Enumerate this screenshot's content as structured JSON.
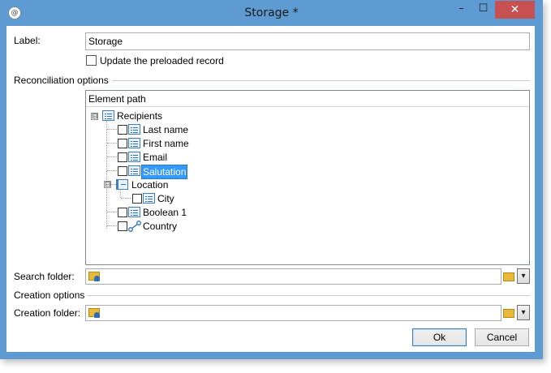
{
  "window": {
    "title": "Storage *",
    "app_icon_glyph": "@",
    "minimize_glyph": "–",
    "maximize_glyph": "☐",
    "close_glyph": "✕"
  },
  "form": {
    "label_caption": "Label:",
    "label_value": "Storage",
    "update_checkbox_label": "Update the preloaded record",
    "update_checked": false
  },
  "reconciliation": {
    "section_title": "Reconciliation options",
    "tree_header": "Element path",
    "nodes": [
      {
        "label": "Recipients",
        "icon": "list-icon",
        "expander": "⊟"
      },
      {
        "label": "Last name",
        "icon": "list-icon"
      },
      {
        "label": "First name",
        "icon": "list-icon"
      },
      {
        "label": "Email",
        "icon": "list-icon"
      },
      {
        "label": "Salutation",
        "icon": "list-icon",
        "selected": true
      },
      {
        "label": "Location",
        "icon": "collection-icon",
        "expander": "⊟"
      },
      {
        "label": "City",
        "icon": "list-icon"
      },
      {
        "label": "Boolean 1",
        "icon": "list-icon"
      },
      {
        "label": "Country",
        "icon": "link-icon"
      }
    ]
  },
  "search_folder": {
    "caption": "Search folder:",
    "value": "",
    "icon": "folder-user-icon"
  },
  "creation": {
    "section_title": "Creation options",
    "folder_caption": "Creation folder:",
    "folder_value": "",
    "icon": "folder-user-icon"
  },
  "buttons": {
    "ok": "Ok",
    "cancel": "Cancel"
  },
  "colors": {
    "title_bar": "#5d9bd2",
    "close_button": "#c75050",
    "selection": "#3399ff"
  }
}
